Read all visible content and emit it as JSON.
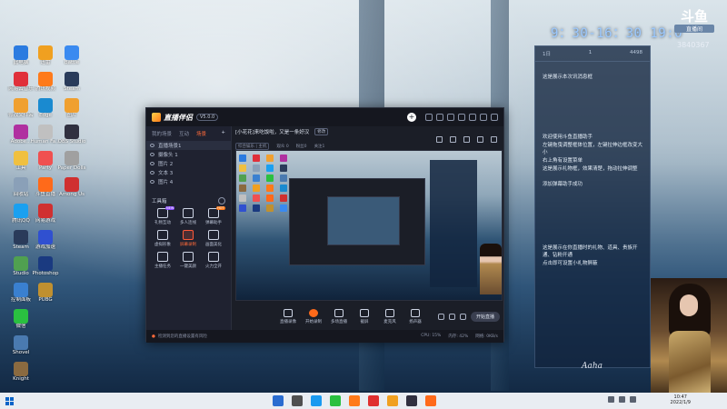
{
  "overlay": {
    "clock": "9：30-16：30 19:0",
    "logo_mark": "斗鱼",
    "logo_sub": "直播间",
    "room_id": "3840367"
  },
  "chat": {
    "stats": [
      "1日",
      "1",
      "4498"
    ],
    "messages": [
      "这是展示本次讯消息框",
      "欢迎使用斗鱼直播助手",
      "左键拖曳调整框体位置，左键拉伸边框改变大小",
      "右上角有设置菜单",
      "这是展示礼物框，效果清楚，拖动拉伸调整",
      "添加弹幕助手成功",
      "这是展示在你直播时的礼物、道具、贵族开通、钻粉开通",
      "点击即可设置小礼物屏蔽"
    ]
  },
  "desktop_icons": [
    {
      "label": "此电脑",
      "color": "#2b7be0"
    },
    {
      "label": "网易云音乐",
      "color": "#e0303a"
    },
    {
      "label": "修改文件名",
      "color": "#f0a030"
    },
    {
      "label": "Adobe...",
      "color": "#b030a0"
    },
    {
      "label": "工具",
      "color": "#f0c040"
    },
    {
      "label": "回收站",
      "color": "#8aa0b8"
    },
    {
      "label": "腾讯QQ",
      "color": "#1aa0f0"
    },
    {
      "label": "Steam",
      "color": "#2a3b5a"
    },
    {
      "label": "Studio",
      "color": "#50a050"
    },
    {
      "label": "控制面板",
      "color": "#3a80d0"
    },
    {
      "label": "微信",
      "color": "#2ac040"
    },
    {
      "label": "Shovel",
      "color": "#4a7ab0"
    },
    {
      "label": "Knight",
      "color": "#8a6a40"
    },
    {
      "label": "迅雷",
      "color": "#f0a020"
    },
    {
      "label": "腾讯视频",
      "color": "#ff7a1a"
    },
    {
      "label": "Edge",
      "color": "#1a8ad0"
    },
    {
      "label": "Human Fa...",
      "color": "#c0c0c0"
    },
    {
      "label": "Party",
      "color": "#f05050"
    },
    {
      "label": "斗鱼直播",
      "color": "#ff6a1a"
    },
    {
      "label": "网易游戏",
      "color": "#d03030"
    },
    {
      "label": "游戏加速",
      "color": "#3050d0"
    },
    {
      "label": "Photoshop",
      "color": "#1a3a80"
    },
    {
      "label": "PUBG",
      "color": "#c09030"
    },
    {
      "label": "Battle",
      "color": "#3a8af0"
    },
    {
      "label": "Steam",
      "color": "#2a3b5a"
    },
    {
      "label": "图片",
      "color": "#f0a030"
    },
    {
      "label": "OBS Studio",
      "color": "#303040"
    },
    {
      "label": "Paper Dolls",
      "color": "#a0a0a0"
    },
    {
      "label": "Among Us",
      "color": "#d03030"
    }
  ],
  "app": {
    "name": "直播伴侣",
    "version": "V5.0.0",
    "left_tabs": [
      "我的场景",
      "互动",
      "场景"
    ],
    "active_tab": "场景",
    "scenes": [
      {
        "label": "直播场景1"
      },
      {
        "label": "摄像头 1"
      },
      {
        "label": "图片 2"
      },
      {
        "label": "文本 3"
      },
      {
        "label": "图片 4"
      }
    ],
    "tools_title": "工具箱",
    "tools": [
      {
        "label": "礼物互动",
        "badge": "NEW",
        "hot": false
      },
      {
        "label": "多人连线",
        "badge": "",
        "hot": false
      },
      {
        "label": "弹幕助手",
        "badge": "HOT",
        "hot": false
      },
      {
        "label": "虚拟形象",
        "badge": "",
        "hot": false
      },
      {
        "label": "屏幕录制",
        "badge": "",
        "hot": true
      },
      {
        "label": "画面美化",
        "badge": "",
        "hot": false
      },
      {
        "label": "主播任务",
        "badge": "",
        "hot": false
      },
      {
        "label": "一键美颜",
        "badge": "",
        "hot": false
      },
      {
        "label": "火力全开",
        "badge": "",
        "hot": false
      }
    ],
    "stream": {
      "title": "[小花花]来吃饭啦，又是一条好汉",
      "edit": "修改",
      "category": "综合娱乐 | 主机",
      "meta1": "观众 0",
      "meta2": "粉丝0",
      "meta3": "关注1"
    },
    "bottom_actions": [
      {
        "label": "直播录像",
        "rec": false
      },
      {
        "label": "开始录制",
        "rec": true
      },
      {
        "label": "多场直播",
        "rec": false
      },
      {
        "label": "截屏",
        "rec": false
      },
      {
        "label": "麦克风",
        "rec": false
      },
      {
        "label": "扬声器",
        "rec": false
      }
    ],
    "go_live": "开始直播",
    "status_warning": "检测到您的直播设置有风险",
    "metrics": [
      "CPU: 15%",
      "内存: 42%",
      "网络: 0KB/s"
    ]
  },
  "taskbar": {
    "time": "10:47",
    "date": "2022/1/9",
    "app_colors": [
      "#2a6cd0",
      "#505050",
      "#1a9af0",
      "#2ac040",
      "#ff7a1a",
      "#e03030",
      "#f0a020",
      "#303040",
      "#ff6a1a"
    ]
  },
  "signature": "Aaha"
}
